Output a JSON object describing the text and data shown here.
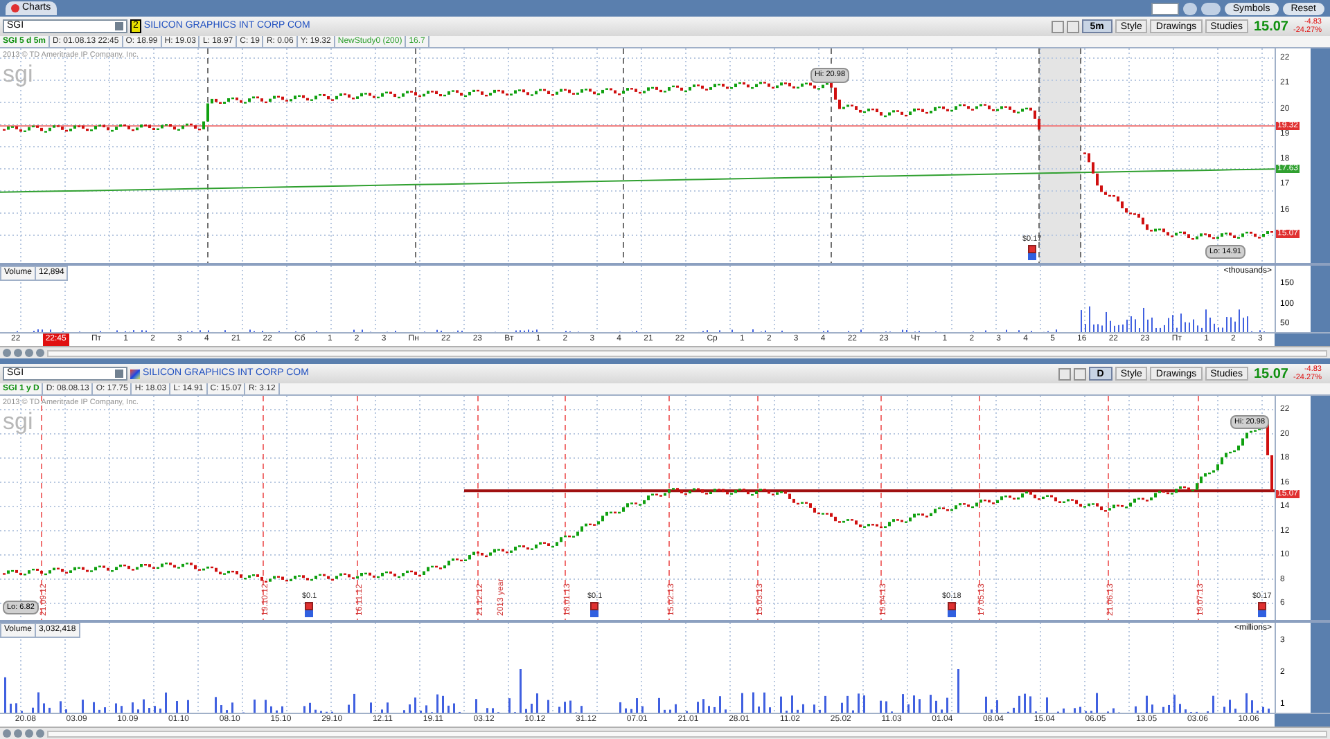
{
  "app_bar": {
    "tab": "Charts",
    "buttons": [
      "Symbols",
      "Reset"
    ]
  },
  "panels": [
    {
      "symbol": "SGI",
      "badge": "2",
      "company": "SILICON GRAPHICS INT CORP COM",
      "timeframe": "5m",
      "tools": [
        "Style",
        "Drawings",
        "Studies"
      ],
      "last": "15.07",
      "change": "-4.83",
      "change_pct": "-24.27%",
      "info": [
        {
          "text": "SGI 5 d 5m",
          "kind": "title"
        },
        {
          "text": "D: 01.08.13 22:45",
          "kind": "field"
        },
        {
          "text": "O: 18.99",
          "kind": "field"
        },
        {
          "text": "H: 19.03",
          "kind": "field"
        },
        {
          "text": "L: 18.97",
          "kind": "field"
        },
        {
          "text": "C: 19",
          "kind": "field"
        },
        {
          "text": "R: 0.06",
          "kind": "field"
        },
        {
          "text": "Y: 19.32",
          "kind": "field"
        },
        {
          "text": "NewStudy0 (200)",
          "kind": "study"
        },
        {
          "text": "16.7",
          "kind": "study"
        }
      ],
      "copyright": "2013 © TD Ameritrade IP Company, Inc.",
      "logo": "sgi",
      "price_axis": [
        "22",
        "21",
        "20",
        "19",
        "18",
        "17",
        "16"
      ],
      "hi": "Hi: 20.98",
      "lo": "Lo: 14.91",
      "price_tags": [
        {
          "text": "19.32",
          "color": "#e03030"
        },
        {
          "text": "17.63",
          "color": "#30a030"
        },
        {
          "text": "15.07",
          "color": "#e03030"
        }
      ],
      "events": [
        "$0.17"
      ],
      "volume": {
        "label": "Volume",
        "value": "12,894",
        "unit": "<thousands>",
        "axis": [
          "150",
          "100",
          "50"
        ]
      },
      "cursor_time": "22:45",
      "time_axis": [
        "22",
        "Пт",
        "1",
        "2",
        "3",
        "4",
        "21",
        "22",
        "Сб",
        "1",
        "2",
        "3",
        "Пн",
        "22",
        "23",
        "Вт",
        "1",
        "2",
        "3",
        "4",
        "21",
        "22",
        "Ср",
        "1",
        "2",
        "3",
        "4",
        "22",
        "23",
        "Чт",
        "1",
        "2",
        "3",
        "4",
        "5",
        "16",
        "22",
        "23",
        "Пт",
        "1",
        "2",
        "3"
      ]
    },
    {
      "symbol": "SGI",
      "company": "SILICON GRAPHICS INT CORP COM",
      "timeframe": "D",
      "tools": [
        "Style",
        "Drawings",
        "Studies"
      ],
      "last": "15.07",
      "change": "-4.83",
      "change_pct": "-24.27%",
      "info": [
        {
          "text": "SGI 1 y D",
          "kind": "title"
        },
        {
          "text": "D: 08.08.13",
          "kind": "field"
        },
        {
          "text": "O: 17.75",
          "kind": "field"
        },
        {
          "text": "H: 18.03",
          "kind": "field"
        },
        {
          "text": "L: 14.91",
          "kind": "field"
        },
        {
          "text": "C: 15.07",
          "kind": "field"
        },
        {
          "text": "R: 3.12",
          "kind": "field"
        }
      ],
      "copyright": "2013 © TD Ameritrade IP Company, Inc.",
      "logo": "sgi",
      "price_axis": [
        "22",
        "20",
        "18",
        "16",
        "14",
        "12",
        "10",
        "8",
        "6"
      ],
      "hi": "Hi: 20.98",
      "lo": "Lo: 6.82",
      "price_tags": [
        {
          "text": "15.07",
          "color": "#e03030"
        }
      ],
      "events": [
        "$0.1",
        "$0.1",
        "$0.18",
        "$0.17"
      ],
      "period_labels": [
        "21.09.12",
        "19.10.12",
        "16.11.12",
        "21.12.12",
        "2013 year",
        "18.01.13",
        "15.02.13",
        "15.03.13",
        "19.04.13",
        "17.05.13",
        "21.06.13",
        "19.07.13"
      ],
      "volume": {
        "label": "Volume",
        "value": "3,032,418",
        "unit": "<millions>",
        "axis": [
          "3",
          "2",
          "1"
        ]
      },
      "time_axis": [
        "20.08",
        "03.09",
        "10.09",
        "01.10",
        "08.10",
        "15.10",
        "29.10",
        "12.11",
        "19.11",
        "03.12",
        "10.12",
        "31.12",
        "07.01",
        "21.01",
        "28.01",
        "11.02",
        "25.02",
        "11.03",
        "01.04",
        "08.04",
        "15.04",
        "06.05",
        "13.05",
        "03.06",
        "10.06"
      ]
    }
  ]
}
